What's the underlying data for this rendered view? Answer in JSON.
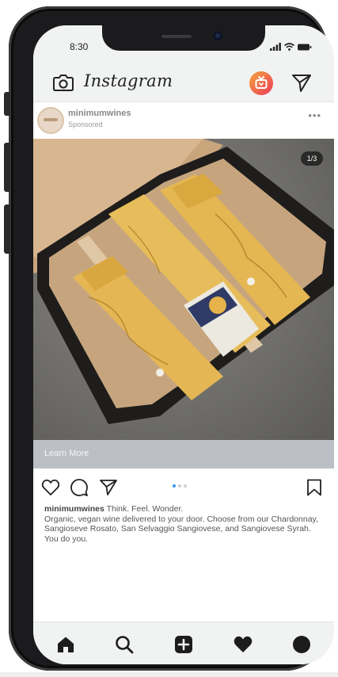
{
  "status_bar": {
    "time": "8:30"
  },
  "app": {
    "logo_text": "Instagram"
  },
  "post": {
    "username": "minimumwines",
    "sponsored_label": "Sponsored",
    "more_label": "•••",
    "image_counter": "1/3",
    "cta_label": "Learn More",
    "carousel": {
      "count": 3,
      "active": 0
    },
    "caption": {
      "username": "minimumwines",
      "headline": "Think. Feel. Wonder.",
      "body": "Organic, vegan wine delivered to your door. Choose from our Chardonnay, Sangioseve Rosato, San Selvaggio Sangiovese, and Sangiovese Syrah. You do you."
    }
  },
  "icons": {
    "camera": "camera-icon",
    "igtv": "igtv-icon",
    "direct": "paper-plane-icon",
    "like": "heart-outline-icon",
    "comment": "comment-icon",
    "share": "paper-plane-icon",
    "save": "bookmark-icon",
    "home": "home-icon",
    "search": "search-icon",
    "add": "add-post-icon",
    "activity": "heart-icon",
    "profile": "profile-icon"
  },
  "colors": {
    "accent": "#3897f0",
    "igtv_start": "#f7a33a",
    "igtv_end": "#ea3b5a",
    "icon": "#222222"
  }
}
